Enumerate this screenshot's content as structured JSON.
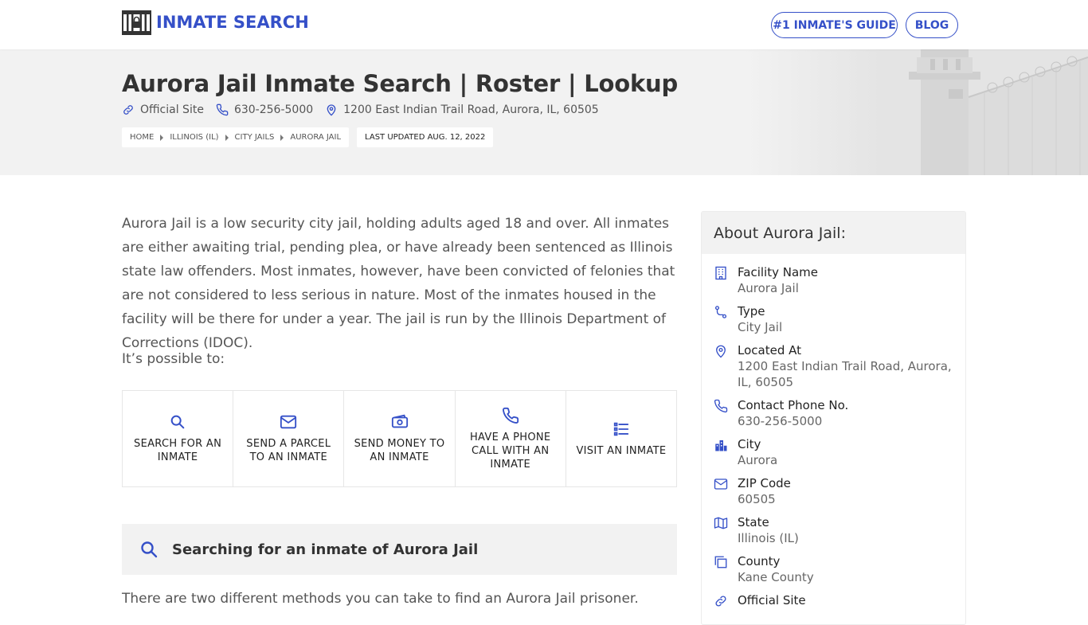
{
  "header": {
    "logo_text": "INMATE SEARCH",
    "nav": {
      "guide": "#1 INMATE'S GUIDE",
      "blog": "BLOG"
    }
  },
  "hero": {
    "title": "Aurora Jail Inmate Search | Roster | Lookup",
    "official_site": "Official Site",
    "phone": "630-256-5000",
    "address": "1200 East Indian Trail Road, Aurora, IL, 60505",
    "breadcrumbs": [
      "HOME",
      "ILLINOIS (IL)",
      "CITY JAILS",
      "AURORA JAIL"
    ],
    "last_updated": "LAST UPDATED AUG. 12, 2022"
  },
  "main": {
    "intro": "Aurora Jail is a low security city jail, holding adults aged 18 and over. All inmates are either awaiting trial, pending plea, or have already been sentenced as Illinois state law offenders. Most inmates, however, have been convicted of felonies that are not considered to less serious in nature. Most of the inmates housed in the facility will be there for under a year. The jail is run by the Illinois Department of Corrections (IDOC).",
    "possible": "It’s possible to:",
    "actions": [
      {
        "label": "SEARCH FOR AN INMATE",
        "icon": "search-icon"
      },
      {
        "label": "SEND A PARCEL TO AN INMATE",
        "icon": "envelope-icon"
      },
      {
        "label": "SEND MONEY TO AN INMATE",
        "icon": "money-icon"
      },
      {
        "label": "HAVE A PHONE CALL WITH AN INMATE",
        "icon": "phone-icon"
      },
      {
        "label": "VISIT AN INMATE",
        "icon": "list-icon"
      }
    ],
    "search_banner": "Searching for an inmate of Aurora Jail",
    "methods": "There are two different methods you can take to find an Aurora Jail prisoner."
  },
  "sidebar": {
    "title": "About Aurora Jail:",
    "items": [
      {
        "label": "Facility Name",
        "value": "Aurora Jail",
        "icon": "building-icon"
      },
      {
        "label": "Type",
        "value": "City Jail",
        "icon": "route-icon"
      },
      {
        "label": "Located At",
        "value": "1200 East Indian Trail Road, Aurora, IL, 60505",
        "icon": "map-pin-icon"
      },
      {
        "label": "Contact Phone No.",
        "value": "630-256-5000",
        "icon": "phone-icon"
      },
      {
        "label": "City",
        "value": "Aurora",
        "icon": "city-icon"
      },
      {
        "label": "ZIP Code",
        "value": "60505",
        "icon": "mail-icon"
      },
      {
        "label": "State",
        "value": "Illinois (IL)",
        "icon": "map-icon"
      },
      {
        "label": "County",
        "value": "Kane County",
        "icon": "copy-icon"
      },
      {
        "label": "Official Site",
        "value": "",
        "icon": "link-icon"
      }
    ]
  },
  "colors": {
    "accent": "#3550c8",
    "panel": "#f2f2f2",
    "text": "#333333"
  }
}
